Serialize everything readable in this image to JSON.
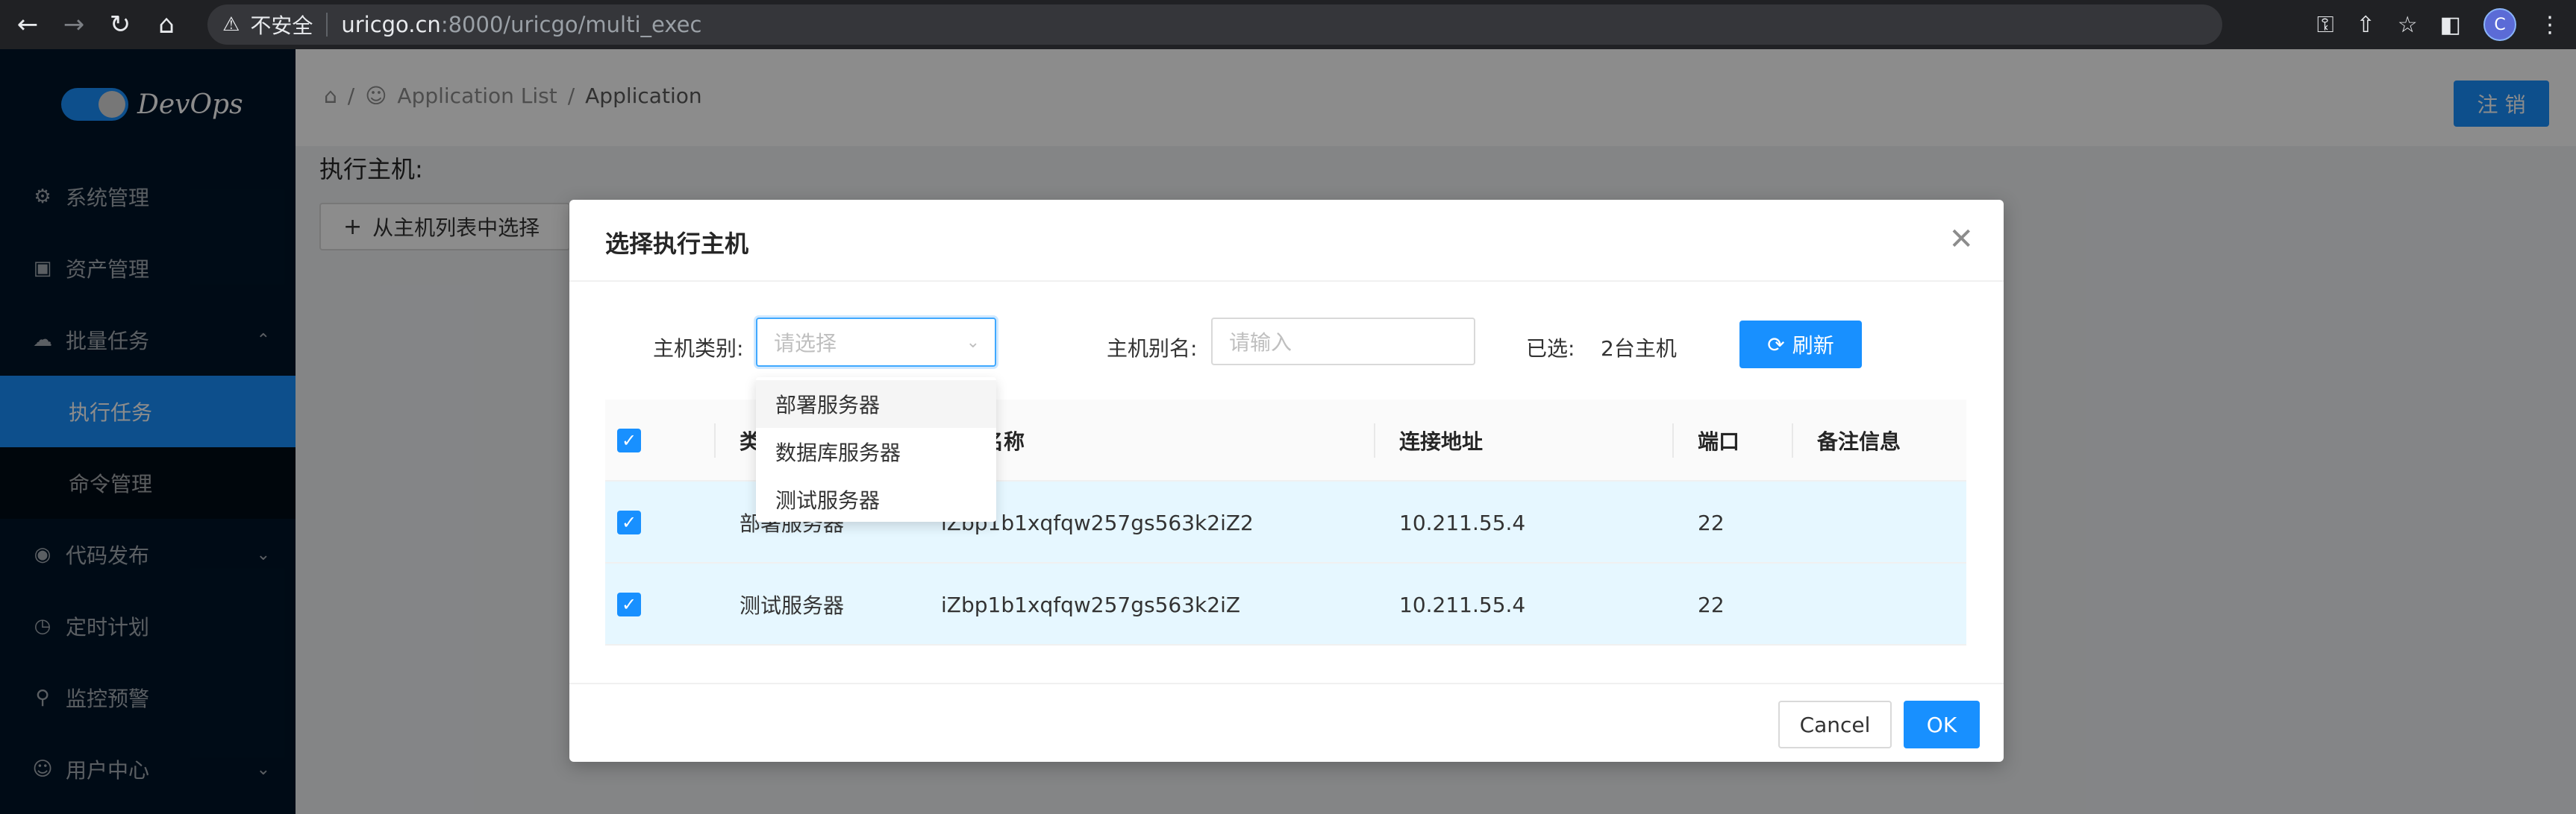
{
  "browser": {
    "insecure_label": "不安全",
    "url_host": "uricgo.cn",
    "url_rest": ":8000/uricgo/multi_exec",
    "profile_initial": "C"
  },
  "sidebar": {
    "logo_text": "DevOps",
    "items": [
      {
        "label": "系统管理",
        "icon": "gear-icon"
      },
      {
        "label": "资产管理",
        "icon": "monitor-icon"
      },
      {
        "label": "批量任务",
        "icon": "cloud-upload-icon"
      },
      {
        "label": "执行任务",
        "icon": ""
      },
      {
        "label": "命令管理",
        "icon": ""
      },
      {
        "label": "代码发布",
        "icon": "github-icon"
      },
      {
        "label": "定时计划",
        "icon": "history-icon"
      },
      {
        "label": "监控预警",
        "icon": "search-icon"
      },
      {
        "label": "用户中心",
        "icon": "user-icon"
      }
    ]
  },
  "header": {
    "breadcrumb": [
      "Application List",
      "Application"
    ],
    "logout_label": "注 销"
  },
  "page": {
    "exec_host_title": "执行主机:",
    "select_from_list": "从主机列表中选择"
  },
  "modal": {
    "title": "选择执行主机",
    "host_type_label": "主机类别:",
    "host_type_placeholder": "请选择",
    "host_alias_label": "主机别名:",
    "host_alias_placeholder": "请输入",
    "selected_label": "已选:",
    "selected_value": "2台主机",
    "refresh_label": "刷新",
    "columns": [
      "类别",
      "主机名称",
      "连接地址",
      "端口",
      "备注信息"
    ],
    "rows": [
      {
        "category": "部署服务器",
        "hostname": "iZbp1b1xqfqw257gs563k2iZ2",
        "address": "10.211.55.4",
        "port": "22",
        "note": ""
      },
      {
        "category": "测试服务器",
        "hostname": "iZbp1b1xqfqw257gs563k2iZ",
        "address": "10.211.55.4",
        "port": "22",
        "note": ""
      }
    ],
    "cancel_label": "Cancel",
    "ok_label": "OK"
  },
  "dropdown": {
    "options": [
      "部署服务器",
      "数据库服务器",
      "测试服务器"
    ]
  }
}
